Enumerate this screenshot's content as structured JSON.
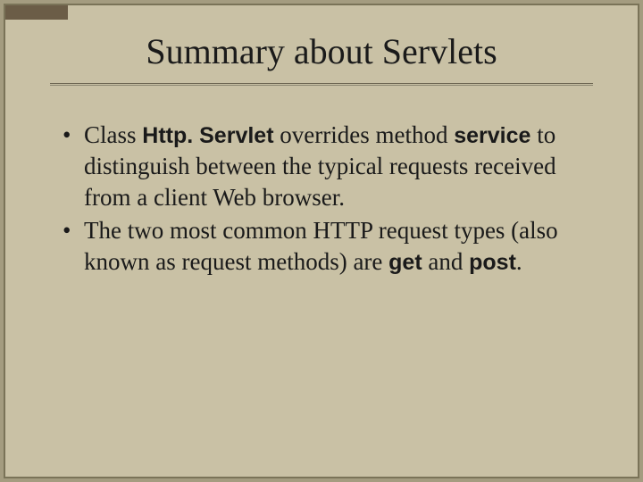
{
  "slide": {
    "title": "Summary about Servlets",
    "bullets": [
      {
        "segments": [
          {
            "text": "Class ",
            "bold": false
          },
          {
            "text": "Http. Servlet",
            "bold": true
          },
          {
            "text": " overrides method ",
            "bold": false
          },
          {
            "text": "service",
            "bold": true
          },
          {
            "text": " to distinguish between the typical requests received from a client Web browser.",
            "bold": false
          }
        ]
      },
      {
        "segments": [
          {
            "text": "The two most common HTTP request types (also known as request methods) are ",
            "bold": false
          },
          {
            "text": "get",
            "bold": true
          },
          {
            "text": " and ",
            "bold": false
          },
          {
            "text": "post",
            "bold": true
          },
          {
            "text": ".",
            "bold": false
          }
        ]
      }
    ]
  }
}
